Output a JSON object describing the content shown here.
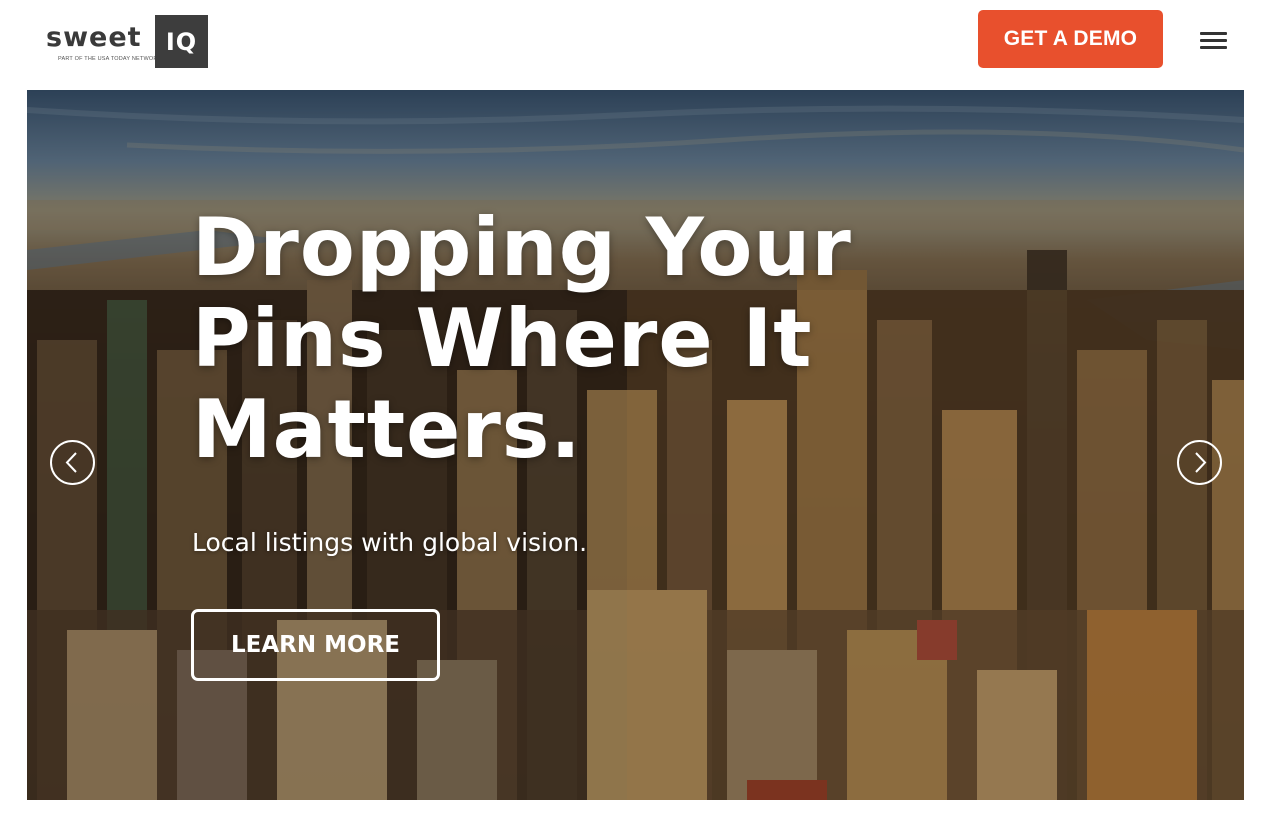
{
  "header": {
    "logo": {
      "word": "sweet",
      "box": "IQ",
      "tagline": "PART OF THE USA TODAY NETWORK"
    },
    "demo_button": "GET A DEMO",
    "menu_icon": "hamburger-menu-icon"
  },
  "hero": {
    "title_lines": [
      "Dropping Your",
      "Pins Where It",
      "Matters."
    ],
    "subtitle": "Local listings with global vision.",
    "cta": "LEARN MORE",
    "prev_icon": "chevron-left-icon",
    "next_icon": "chevron-right-icon",
    "background": "aerial-city-skyline-photo"
  },
  "colors": {
    "accent": "#e8502d",
    "logo_dark": "#3d3d3d",
    "text_light": "#ffffff"
  }
}
